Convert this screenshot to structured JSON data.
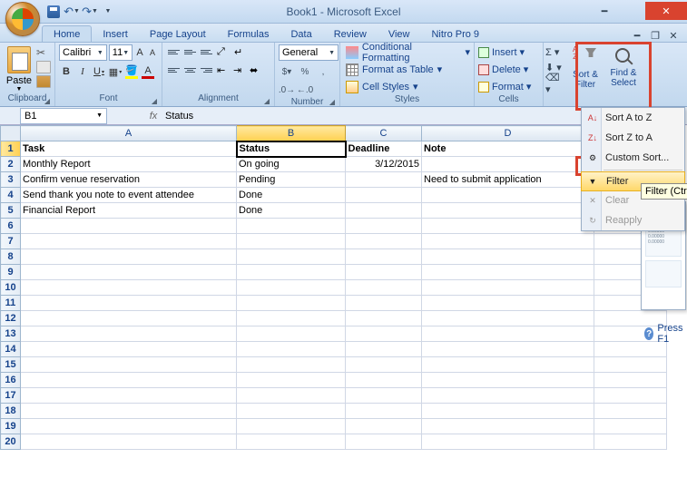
{
  "title": "Book1 - Microsoft Excel",
  "tabs": [
    "Home",
    "Insert",
    "Page Layout",
    "Formulas",
    "Data",
    "Review",
    "View",
    "Nitro Pro 9"
  ],
  "active_tab": 0,
  "ribbon": {
    "clipboard": {
      "paste": "Paste",
      "label": "Clipboard"
    },
    "font": {
      "name": "Calibri",
      "size": "11",
      "label": "Font"
    },
    "alignment": {
      "label": "Alignment"
    },
    "number": {
      "format": "General",
      "label": "Number"
    },
    "styles": {
      "cond": "Conditional Formatting",
      "table": "Format as Table",
      "cell": "Cell Styles",
      "label": "Styles"
    },
    "cells": {
      "insert": "Insert",
      "delete": "Delete",
      "format": "Format",
      "label": "Cells"
    },
    "editing": {
      "sort": "Sort & Filter",
      "find": "Find & Select"
    }
  },
  "sort_menu": {
    "az": "Sort A to Z",
    "za": "Sort Z to A",
    "custom": "Custom Sort...",
    "filter": "Filter",
    "clear": "Clear",
    "reapply": "Reapply"
  },
  "tooltip": "Filter (Ctrl+Shift+L)",
  "help_hint": "Press F1",
  "namebox": "B1",
  "formula": "Status",
  "columns": [
    "A",
    "B",
    "C",
    "D"
  ],
  "headers": {
    "A": "Task",
    "B": "Status",
    "C": "Deadline",
    "D": "Note"
  },
  "rows": [
    {
      "A": "Monthly Report",
      "B": "On going",
      "C": "3/12/2015",
      "D": ""
    },
    {
      "A": "Confirm venue reservation",
      "B": "Pending",
      "C": "",
      "D": "Need to submit application"
    },
    {
      "A": "Send thank you note to event attendee",
      "B": "Done",
      "C": "",
      "D": ""
    },
    {
      "A": "Financial Report",
      "B": "Done",
      "C": "",
      "D": ""
    }
  ],
  "row_count": 20,
  "active_cell": "B1"
}
